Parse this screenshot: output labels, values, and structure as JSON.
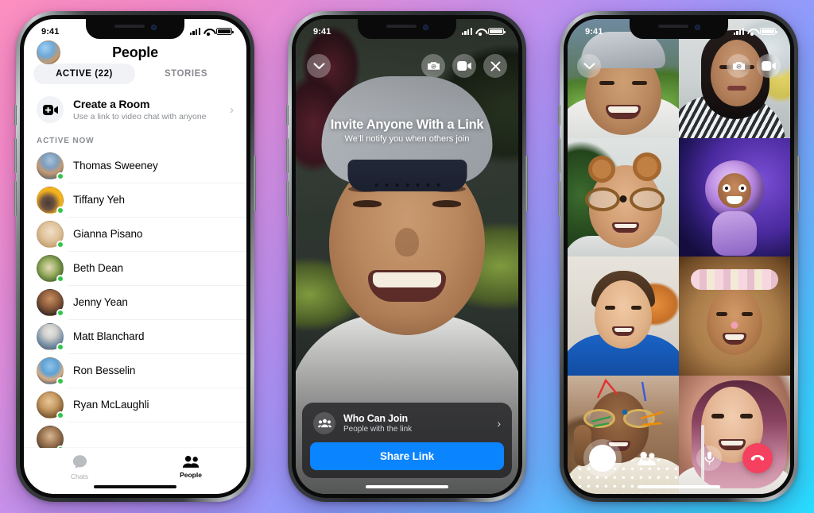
{
  "background": {
    "gradient_from": "#fc8fc0",
    "gradient_mid": "#b292f5",
    "gradient_to": "#28dcff"
  },
  "phone1": {
    "status": {
      "time": "9:41"
    },
    "header": {
      "title": "People",
      "avatar": "user-avatar"
    },
    "tabs": [
      {
        "label": "ACTIVE (22)",
        "active": true
      },
      {
        "label": "STORIES",
        "active": false
      }
    ],
    "create_room": {
      "title": "Create a Room",
      "subtitle": "Use a link to video chat with anyone",
      "icon": "video-plus-icon",
      "chevron": "›"
    },
    "section_label": "ACTIVE NOW",
    "contacts": [
      {
        "name": "Thomas Sweeney",
        "online": true
      },
      {
        "name": "Tiffany Yeh",
        "online": true
      },
      {
        "name": "Gianna Pisano",
        "online": true
      },
      {
        "name": "Beth Dean",
        "online": true
      },
      {
        "name": "Jenny Yean",
        "online": true
      },
      {
        "name": "Matt Blanchard",
        "online": true
      },
      {
        "name": "Ron Besselin",
        "online": true
      },
      {
        "name": "Ryan McLaughli",
        "online": true
      }
    ],
    "tabbar": [
      {
        "label": "Chats",
        "icon": "chat-bubble-icon",
        "active": false
      },
      {
        "label": "People",
        "icon": "people-icon",
        "active": true
      }
    ]
  },
  "phone2": {
    "status": {
      "time": "9:41"
    },
    "top_controls": [
      {
        "name": "minimize-chevron-down",
        "icon": "chevron-down-icon"
      },
      {
        "name": "switch-camera",
        "icon": "camera-flip-icon"
      },
      {
        "name": "toggle-video",
        "icon": "video-camera-icon"
      },
      {
        "name": "close-call",
        "icon": "close-x-icon"
      }
    ],
    "headline": "Invite Anyone With a Link",
    "subheadline": "We’ll notify you when others join",
    "who_can_join": {
      "title": "Who Can Join",
      "subtitle": "People with the link",
      "icon": "people-group-icon",
      "chevron": "›"
    },
    "share_button": {
      "label": "Share Link",
      "color": "#0a84ff"
    }
  },
  "phone3": {
    "status": {
      "time": "9:41"
    },
    "top_controls": [
      {
        "name": "minimize-chevron-down",
        "icon": "chevron-down-icon"
      },
      {
        "name": "switch-camera",
        "icon": "camera-flip-icon"
      },
      {
        "name": "toggle-video",
        "icon": "video-camera-icon"
      }
    ],
    "participant_count": 8,
    "participants": [
      {
        "slot": 1,
        "description": "man-in-backwards-cap-outdoors"
      },
      {
        "slot": 2,
        "description": "woman-with-striped-top-indoors"
      },
      {
        "slot": 3,
        "description": "man-with-bear-ears-filter-and-glasses"
      },
      {
        "slot": 4,
        "description": "astronaut-avatar-effect"
      },
      {
        "slot": 5,
        "description": "man-in-blue-hoodie"
      },
      {
        "slot": 6,
        "description": "woman-with-flower-crown-filter"
      },
      {
        "slot": 7,
        "description": "woman-with-glasses-peace-sign"
      },
      {
        "slot": 8,
        "description": "woman-with-pink-hair-earphones"
      }
    ],
    "bottom_controls": [
      {
        "name": "camera-shutter",
        "icon": "shutter-circle-icon"
      },
      {
        "name": "add-people",
        "icon": "people-icon"
      },
      {
        "name": "mute-microphone",
        "icon": "microphone-icon"
      },
      {
        "name": "end-call",
        "icon": "phone-hangup-icon",
        "color": "#f5415f"
      }
    ]
  }
}
